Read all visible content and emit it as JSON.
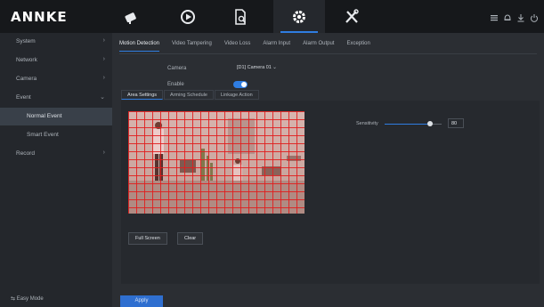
{
  "app": {
    "logo": "ANNKE"
  },
  "topnav": {
    "items": [
      {
        "icon": "camera-icon",
        "active": false
      },
      {
        "icon": "playback-icon",
        "active": false
      },
      {
        "icon": "file-search-icon",
        "active": false
      },
      {
        "icon": "gear-icon",
        "active": true
      },
      {
        "icon": "tools-icon",
        "active": false
      }
    ],
    "status_icons": [
      "task-list-icon",
      "alarm-icon",
      "download-icon",
      "power-icon"
    ]
  },
  "sidebar": {
    "items": [
      {
        "label": "System",
        "arrow": "›"
      },
      {
        "label": "Network",
        "arrow": "›"
      },
      {
        "label": "Camera",
        "arrow": "›"
      },
      {
        "label": "Event",
        "arrow": "⌄"
      },
      {
        "label": "Normal Event",
        "arrow": ""
      },
      {
        "label": "Smart Event",
        "arrow": ""
      },
      {
        "label": "Record",
        "arrow": "›"
      }
    ],
    "easy_mode": "⇆ Easy Mode"
  },
  "tabs": [
    "Motion Detection",
    "Video Tampering",
    "Video Loss",
    "Alarm Input",
    "Alarm Output",
    "Exception"
  ],
  "form": {
    "camera_label": "Camera",
    "camera_value": "[D1] Camera 01",
    "enable_label": "Enable",
    "enable_on": true
  },
  "subtabs": [
    "Area Settings",
    "Arming Schedule",
    "Linkage Action"
  ],
  "buttons": {
    "full_screen": "Full Screen",
    "clear": "Clear",
    "apply": "Apply"
  },
  "sensitivity": {
    "label": "Sensitivity",
    "value": "80",
    "level": 0.8
  },
  "colors": {
    "accent": "#2f7de1",
    "grid": "#e11e1e",
    "background": "#2b2e33",
    "topbar": "#16181b"
  }
}
